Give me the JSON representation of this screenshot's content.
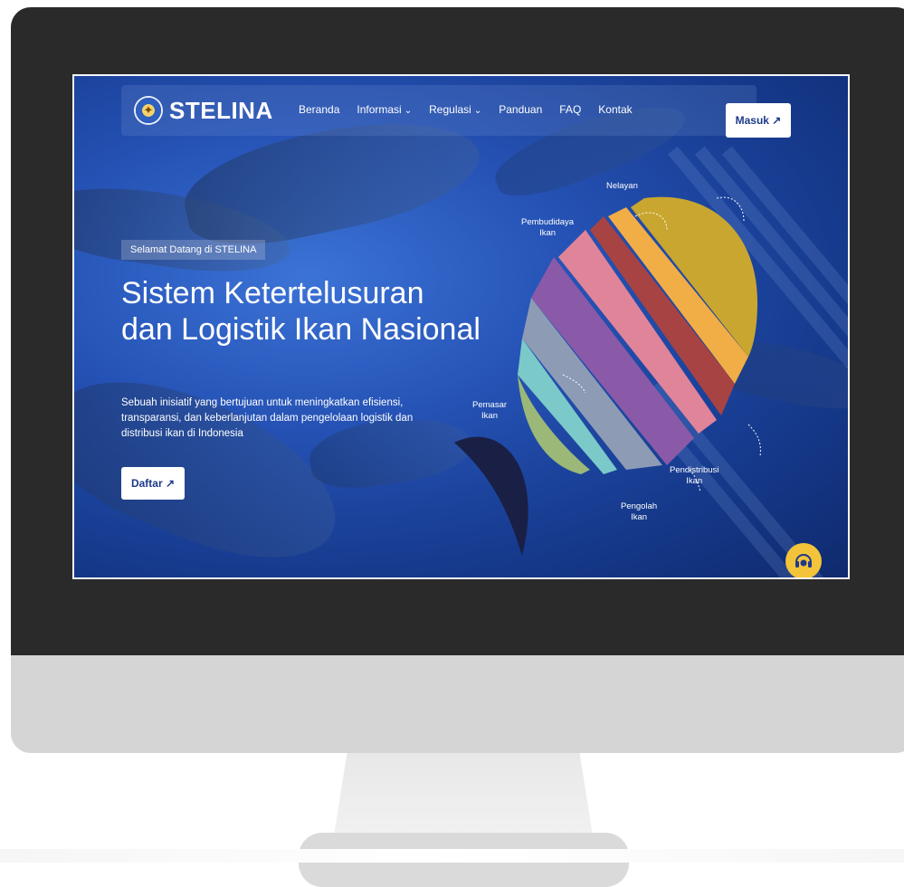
{
  "brand": {
    "name": "STELINA"
  },
  "nav": {
    "items": [
      {
        "label": "Beranda",
        "has_dropdown": false
      },
      {
        "label": "Informasi",
        "has_dropdown": true
      },
      {
        "label": "Regulasi",
        "has_dropdown": true
      },
      {
        "label": "Panduan",
        "has_dropdown": false
      },
      {
        "label": "FAQ",
        "has_dropdown": false
      },
      {
        "label": "Kontak",
        "has_dropdown": false
      }
    ],
    "login_label": "Masuk ↗"
  },
  "hero": {
    "welcome": "Selamat Datang di STELINA",
    "title": "Sistem Ketertelusuran dan Logistik Ikan Nasional",
    "description": "Sebuah inisiatif yang bertujuan untuk meningkatkan efisiensi, transparansi, dan keberlanjutan dalam pengelolaan logistik dan distribusi ikan di Indonesia",
    "register_label": "Daftar ↗"
  },
  "graphic": {
    "labels": {
      "nelayan": "Nelayan",
      "pembudidaya": "Pembudidaya\nIkan",
      "pemasar": "Pemasar\nIkan",
      "pengolah": "Pengolah\nIkan",
      "pendistribusi": "Pendistribusi\nIkan"
    }
  },
  "colors": {
    "brand_blue": "#1e3a8a",
    "support_yellow": "#f3c43a",
    "bezel": "#2a2a2a"
  },
  "icons": {
    "support": "headset-icon",
    "dropdown": "chevron-down-icon",
    "external": "arrow-up-right-icon"
  }
}
